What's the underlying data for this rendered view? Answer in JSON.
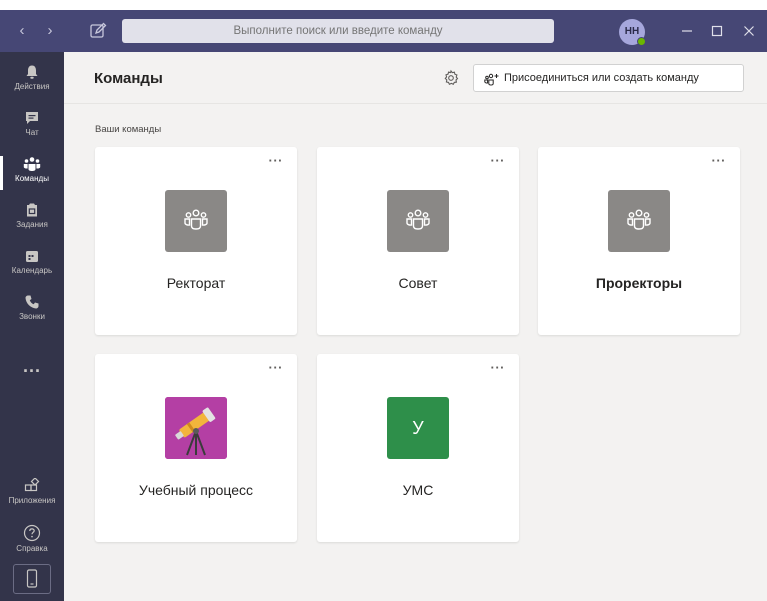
{
  "search": {
    "placeholder": "Выполните поиск или введите команду"
  },
  "user": {
    "initials": "НН"
  },
  "rail": {
    "items": [
      {
        "label": "Действия"
      },
      {
        "label": "Чат"
      },
      {
        "label": "Команды"
      },
      {
        "label": "Задания"
      },
      {
        "label": "Календарь"
      },
      {
        "label": "Звонки"
      }
    ],
    "more": "...",
    "apps": "Приложения",
    "help": "Справка"
  },
  "header": {
    "title": "Команды",
    "join_label": "Присоединиться или создать команду"
  },
  "section": {
    "label": "Ваши команды"
  },
  "teams": [
    {
      "name": "Ректорат",
      "avatar": "team-icon"
    },
    {
      "name": "Совет",
      "avatar": "team-icon"
    },
    {
      "name": "Проректоры",
      "avatar": "team-icon"
    },
    {
      "name": "Учебный процесс",
      "avatar": "telescope-image"
    },
    {
      "name": "УМС",
      "avatar": "letter",
      "letter": "У"
    }
  ],
  "colors": {
    "titlebar": "#464775",
    "rail": "#33344a",
    "accent_green": "#2e8f4a",
    "avatar_grey": "#8a8886"
  }
}
